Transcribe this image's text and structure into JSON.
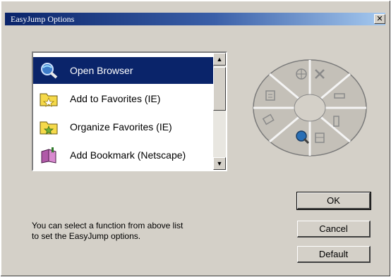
{
  "window": {
    "title": "EasyJump Options",
    "close_symbol": "✕"
  },
  "list": {
    "items": [
      {
        "label": "Open Browser",
        "icon": "browser-search-icon",
        "selected": true
      },
      {
        "label": "Add to Favorites (IE)",
        "icon": "add-favorites-folder-icon",
        "selected": false
      },
      {
        "label": "Organize Favorites (IE)",
        "icon": "organize-favorites-folder-icon",
        "selected": false
      },
      {
        "label": "Add Bookmark (Netscape)",
        "icon": "bookmark-book-icon",
        "selected": false
      }
    ],
    "scroll_up": "▲",
    "scroll_down": "▼"
  },
  "wheel": {
    "segments": [
      "move-icon",
      "close-x-icon",
      "minimize-icon",
      "restore-icon",
      "page-icon",
      "browser-search-icon",
      "favorites-icon",
      "document-icon"
    ],
    "highlight_segment": "browser-search-icon"
  },
  "buttons": {
    "ok": "OK",
    "cancel": "Cancel",
    "default": "Default"
  },
  "hint": {
    "line1": "You can select a function from above list",
    "line2": "to set the EasyJump options."
  },
  "colors": {
    "selection": "#0a246a",
    "dialog": "#d4d0c8"
  }
}
